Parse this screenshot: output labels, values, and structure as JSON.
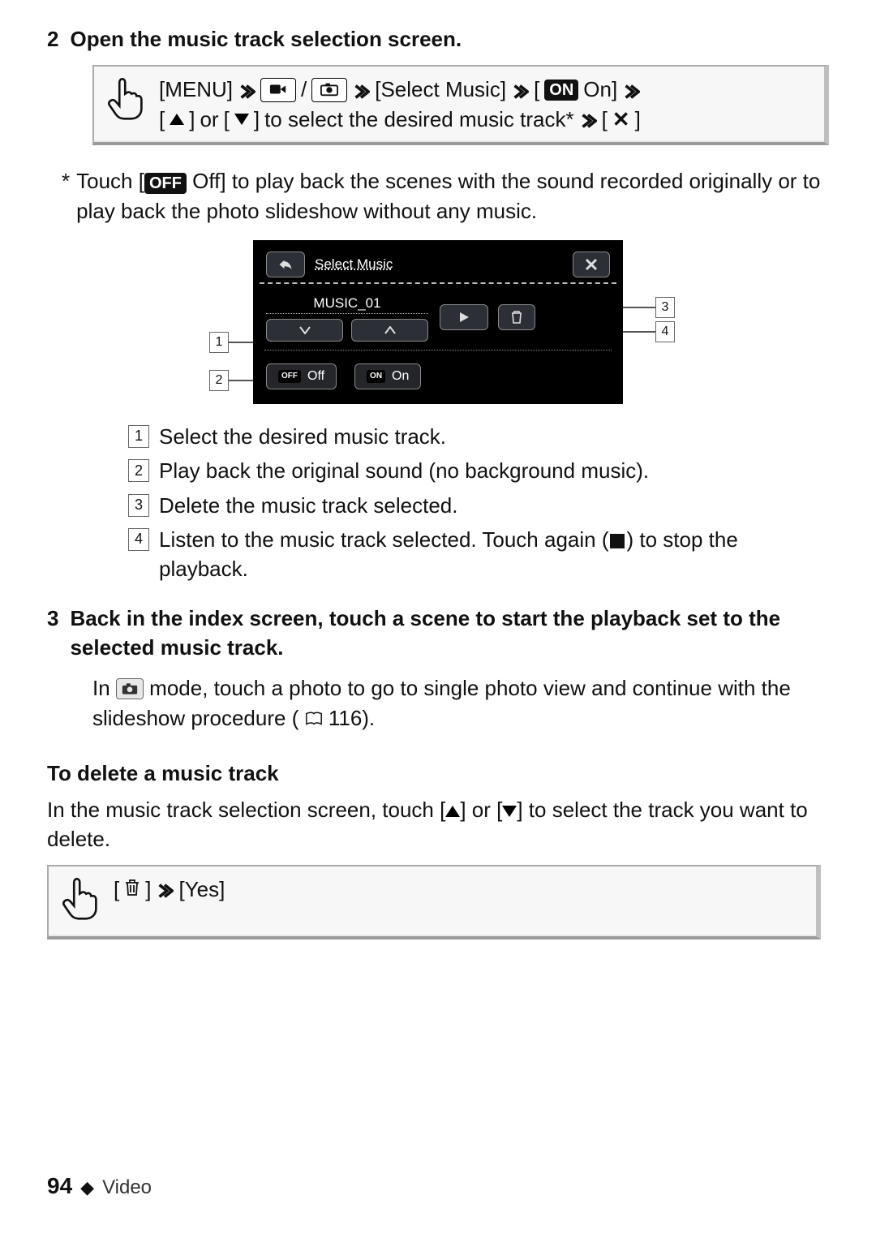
{
  "step2": {
    "number": "2",
    "heading": "Open the music track selection screen.",
    "nav": {
      "menu": "[MENU]",
      "slash": "/",
      "select_music": "[Select Music]",
      "on_badge": "ON",
      "on_bracket_close": "On]",
      "updown_text": "or",
      "updown_suffix": "to select the desired music track*"
    }
  },
  "footnote": {
    "asterisk": "*",
    "text_prefix": "Touch [",
    "off_badge": "OFF",
    "text_rest": " Off] to play back the scenes with the sound recorded originally or to play back the photo slideshow without any music."
  },
  "screenshot": {
    "title": "Select Music",
    "track_name": "MUSIC_01",
    "off_label": "Off",
    "off_badge": "OFF",
    "on_label": "On",
    "on_badge": "ON",
    "callouts": {
      "c1": "1",
      "c2": "2",
      "c3": "3",
      "c4": "4"
    }
  },
  "legend": {
    "c1": {
      "n": "1",
      "t": "Select the desired music track."
    },
    "c2": {
      "n": "2",
      "t": "Play back the original sound (no background music)."
    },
    "c3": {
      "n": "3",
      "t": "Delete the music track selected."
    },
    "c4": {
      "n": "4",
      "t_a": "Listen to the music track selected. Touch again (",
      "t_b": ") to stop the playback."
    }
  },
  "step3": {
    "number": "3",
    "heading": "Back in the index screen, touch a scene to start the playback set to the selected music track.",
    "para_a": "In ",
    "para_b": " mode, touch a photo to go to single photo view and continue with the slideshow procedure (",
    "page_ref": " 116)."
  },
  "delete_section": {
    "heading": "To delete a music track",
    "para_a": "In the music track selection screen, touch [",
    "para_mid": "] or [",
    "para_end": "] to select the track you want to delete.",
    "nav_yes": "[Yes]"
  },
  "footer": {
    "page": "94",
    "sep": "◆",
    "section": "Video"
  }
}
